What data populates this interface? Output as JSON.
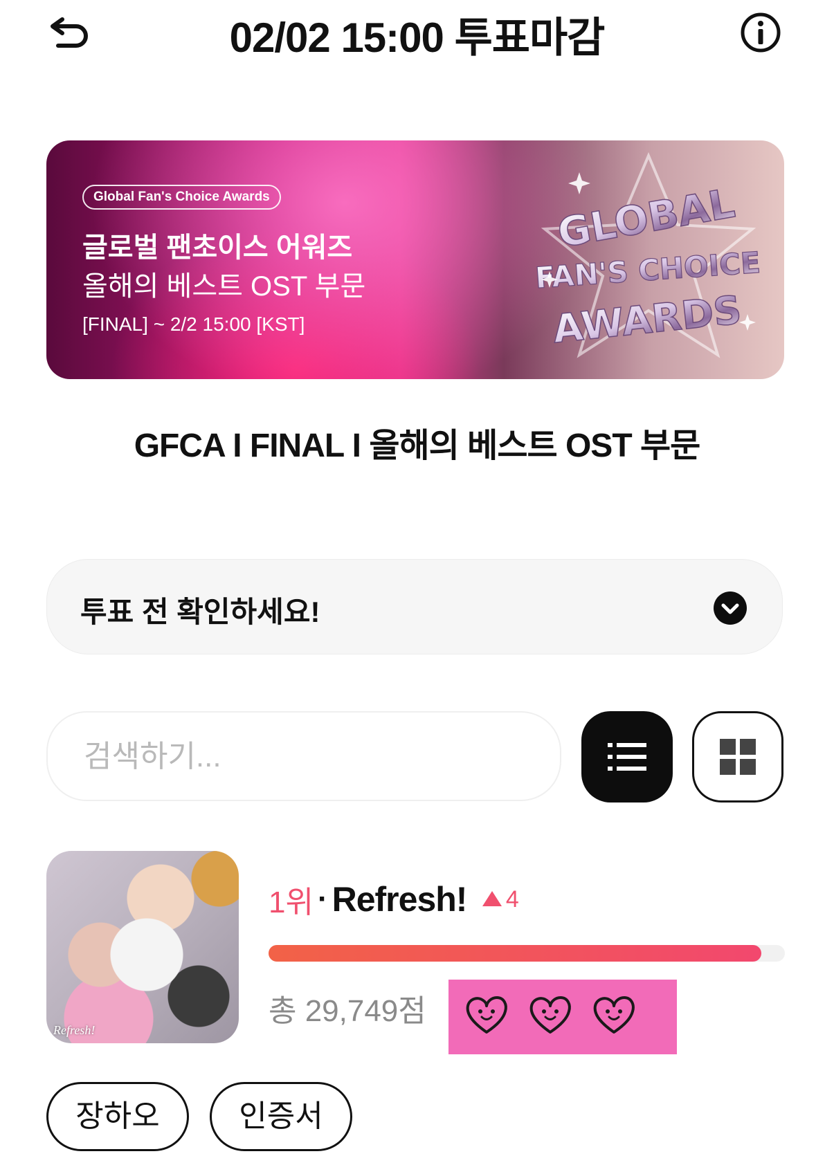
{
  "header": {
    "title": "02/02 15:00 투표마감",
    "back_icon": "undo-arrow-icon",
    "info_icon": "info-circle-icon"
  },
  "banner": {
    "pill": "Global Fan's Choice Awards",
    "line1": "글로벌 팬초이스 어워즈",
    "line2": "올해의 베스트 OST 부문",
    "line3": "[FINAL] ~ 2/2 15:00 [KST]",
    "logo_text": [
      "GLOBAL",
      "FAN'S CHOICE",
      "AWARDS"
    ]
  },
  "category_title": "GFCA I FINAL I 올해의 베스트 OST 부문",
  "notice": {
    "label": "투표 전 확인하세요!",
    "icon": "chevron-down-circle-icon"
  },
  "search": {
    "placeholder": "검색하기..."
  },
  "view_toggle": {
    "list_icon": "list-view-icon",
    "grid_icon": "grid-view-icon",
    "active": "list"
  },
  "entry": {
    "rank": "1위",
    "separator": "·",
    "title": "Refresh!",
    "rank_change": "4",
    "rank_change_direction": "up",
    "progress_fraction": 0.955,
    "total_score": "총 29,749점",
    "thumb_caption": "Refresh!",
    "tags": [
      "장하오",
      "인증서"
    ],
    "sticker_icon": "smiling-heart-icon"
  },
  "colors": {
    "accent": "#f0506e",
    "progress_start": "#f26247",
    "progress_end": "#f2486e",
    "sticker_bg": "#f26bb8"
  }
}
